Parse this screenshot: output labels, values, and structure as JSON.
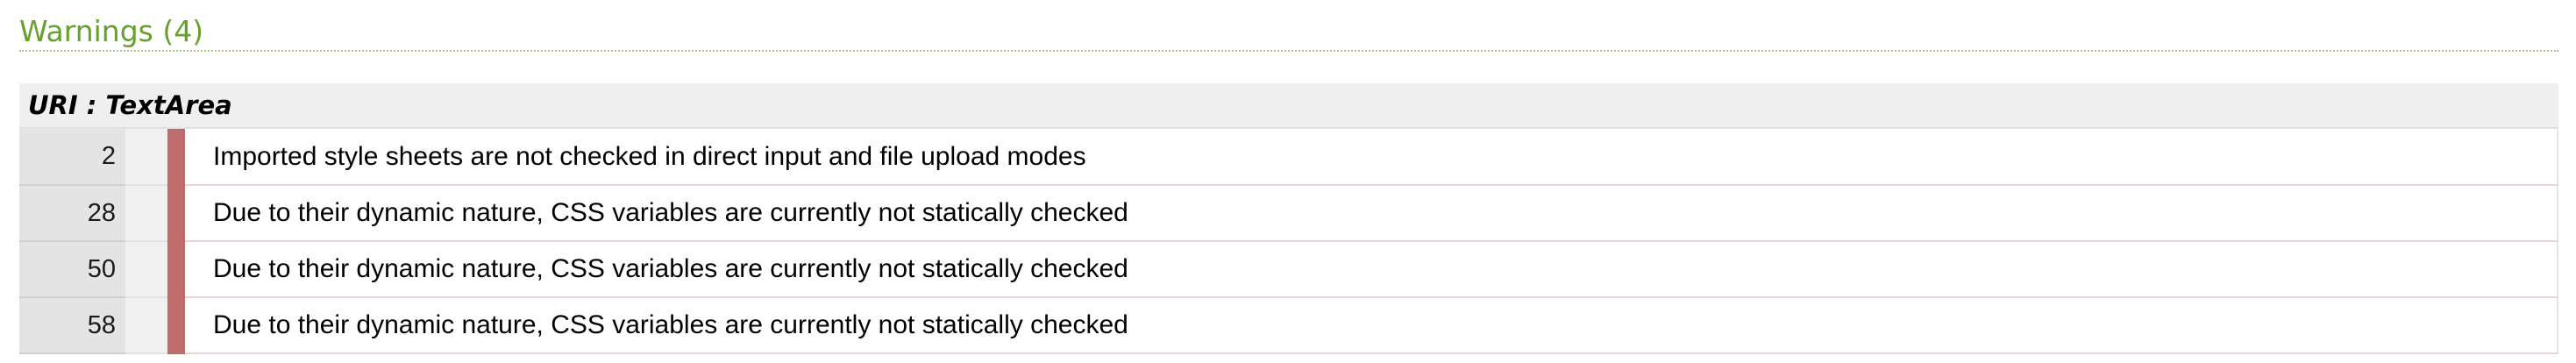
{
  "warnings": {
    "title": "Warnings (4)",
    "uri_label": "URI : TextArea",
    "items": [
      {
        "line": "2",
        "message": "Imported style sheets are not checked in direct input and file upload modes"
      },
      {
        "line": "28",
        "message": "Due to their dynamic nature, CSS variables are currently not statically checked"
      },
      {
        "line": "50",
        "message": "Due to their dynamic nature, CSS variables are currently not statically checked"
      },
      {
        "line": "58",
        "message": "Due to their dynamic nature, CSS variables are currently not statically checked"
      }
    ]
  },
  "colors": {
    "title": "#67a12c",
    "marker": "#bf6c6f",
    "row_border": "#f3cfd4"
  }
}
